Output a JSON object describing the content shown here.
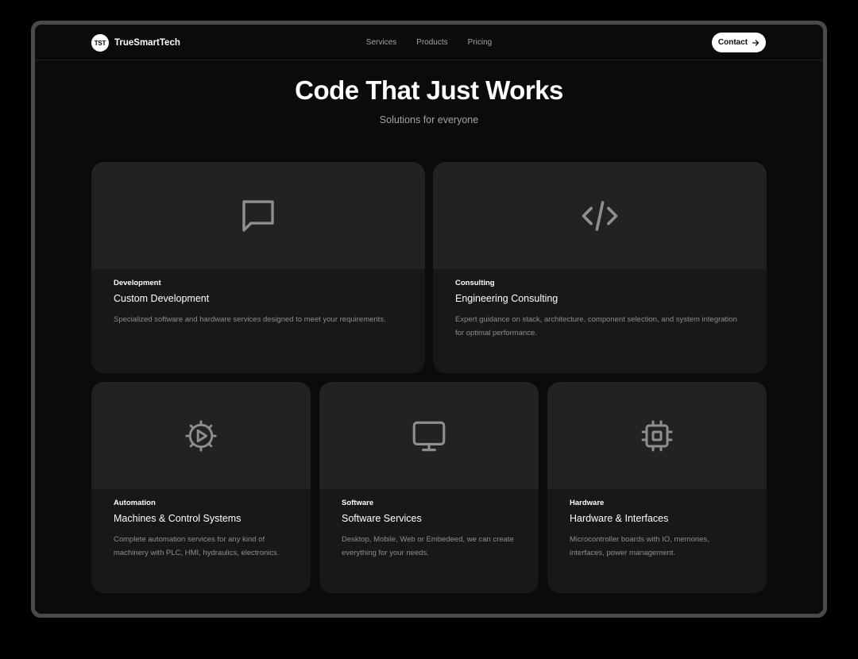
{
  "nav": {
    "logo_mark": "TST",
    "brand": "TrueSmartTech",
    "links": [
      "Services",
      "Products",
      "Pricing"
    ],
    "contact_label": "Contact"
  },
  "hero": {
    "title": "Code That Just Works",
    "subtitle": "Solutions for everyone"
  },
  "cards": [
    {
      "icon": "message-icon",
      "tag": "Development",
      "title": "Custom Development",
      "description": "Specialized software and hardware services designed to meet your requirements."
    },
    {
      "icon": "code-icon",
      "tag": "Consulting",
      "title": "Engineering Consulting",
      "description": "Expert guidance on stack, architecture, component selection, and system integration for optimal performance."
    },
    {
      "icon": "cog-play-icon",
      "tag": "Automation",
      "title": "Machines & Control Systems",
      "description": "Complete automation services for any kind of machinery with PLC, HMI, hydraulics, electronics."
    },
    {
      "icon": "monitor-icon",
      "tag": "Software",
      "title": "Software Services",
      "description": "Desktop, Mobile, Web or Embedeed, we can create everything for your needs."
    },
    {
      "icon": "cpu-icon",
      "tag": "Hardware",
      "title": "Hardware & Interfaces",
      "description": "Microcontroller boards with IO, memories, interfaces, power management."
    }
  ],
  "colors": {
    "background": "#000000",
    "screen": "#0b0b0c",
    "card": "#18181a",
    "card_top": "#222224",
    "icon": "#8f8f93",
    "text_primary": "#ffffff",
    "text_muted": "#8e8e92"
  }
}
